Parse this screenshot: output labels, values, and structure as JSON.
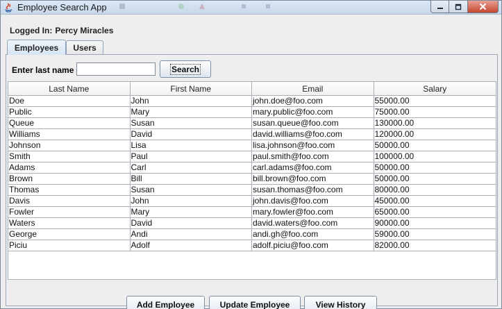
{
  "window": {
    "title": "Employee Search App",
    "controls": {
      "minimize": "minimize-icon",
      "maximize": "maximize-icon",
      "close": "close-icon"
    }
  },
  "header": {
    "logged_in_label": "Logged In:",
    "user_name": "Percy Miracles"
  },
  "tabs": [
    {
      "label": "Employees",
      "active": true
    },
    {
      "label": "Users",
      "active": false
    }
  ],
  "search": {
    "label": "Enter last name",
    "value": "",
    "button_label": "Search"
  },
  "table": {
    "columns": [
      "Last Name",
      "First Name",
      "Email",
      "Salary"
    ],
    "rows": [
      [
        "Doe",
        "John",
        "john.doe@foo.com",
        "55000.00"
      ],
      [
        "Public",
        "Mary",
        "mary.public@foo.com",
        "75000.00"
      ],
      [
        "Queue",
        "Susan",
        "susan.queue@foo.com",
        "130000.00"
      ],
      [
        "Williams",
        "David",
        "david.williams@foo.com",
        "120000.00"
      ],
      [
        "Johnson",
        "Lisa",
        "lisa.johnson@foo.com",
        "50000.00"
      ],
      [
        "Smith",
        "Paul",
        "paul.smith@foo.com",
        "100000.00"
      ],
      [
        "Adams",
        "Carl",
        "carl.adams@foo.com",
        "50000.00"
      ],
      [
        "Brown",
        "Bill",
        "bill.brown@foo.com",
        "50000.00"
      ],
      [
        "Thomas",
        "Susan",
        "susan.thomas@foo.com",
        "80000.00"
      ],
      [
        "Davis",
        "John",
        "john.davis@foo.com",
        "45000.00"
      ],
      [
        "Fowler",
        "Mary",
        "mary.fowler@foo.com",
        "65000.00"
      ],
      [
        "Waters",
        "David",
        "david.waters@foo.com",
        "90000.00"
      ],
      [
        "George",
        "Andi",
        "andi.gh@foo.com",
        "59000.00"
      ],
      [
        "Piciu",
        "Adolf",
        "adolf.piciu@foo.com",
        "82000.00"
      ]
    ]
  },
  "actions": {
    "add_label": "Add Employee",
    "update_label": "Update Employee",
    "history_label": "View History"
  },
  "colors": {
    "titlebar": "#c7d7ea",
    "close_button": "#c5452f",
    "tab_active": "#d6e4f3",
    "grid_line": "#a8b1bb"
  }
}
